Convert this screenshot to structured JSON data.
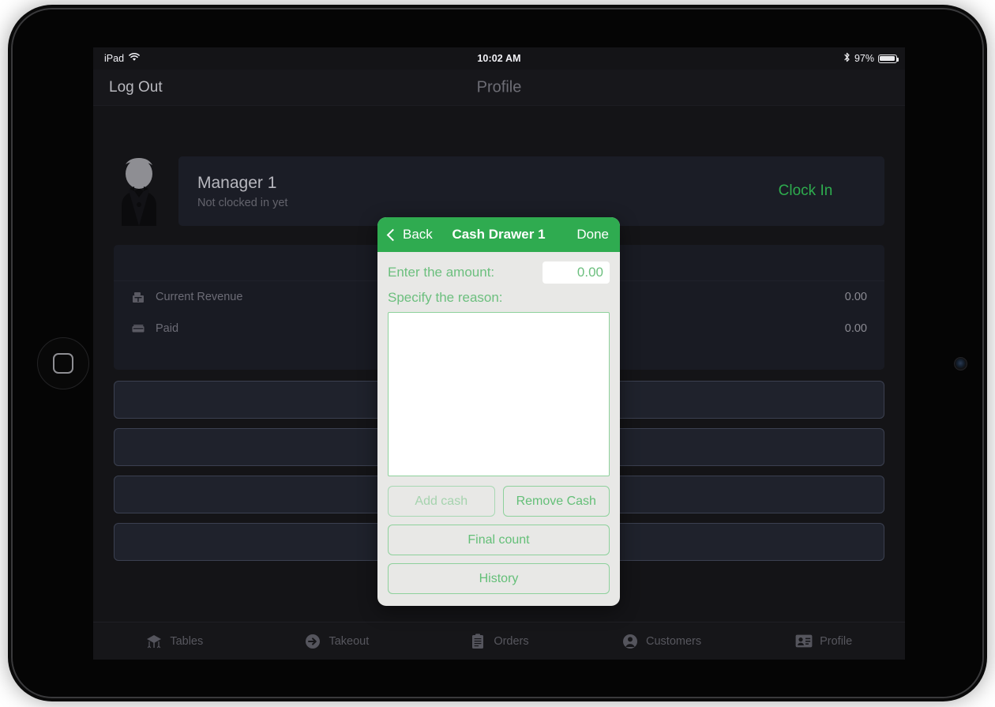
{
  "status_bar": {
    "device_label": "iPad",
    "wifi_icon": "wifi-icon",
    "time": "10:02 AM",
    "bluetooth_icon": "bluetooth-icon",
    "battery_percent": "97%",
    "battery_icon": "battery-icon"
  },
  "nav_bar": {
    "logout_label": "Log Out",
    "title": "Profile"
  },
  "profile": {
    "avatar_icon": "user-avatar-icon",
    "name": "Manager 1",
    "status": "Not clocked in yet",
    "clock_in_label": "Clock In"
  },
  "stats": {
    "rows": [
      {
        "icon": "register-icon",
        "label": "Current Revenue",
        "value": "0.00"
      },
      {
        "icon": "card-icon",
        "label": "Paid",
        "value": "0.00"
      }
    ]
  },
  "action_rows": [
    {
      "label": ""
    },
    {
      "label": ""
    },
    {
      "label": ""
    },
    {
      "label": ""
    }
  ],
  "tab_bar": {
    "items": [
      {
        "icon": "table-icon",
        "label": "Tables"
      },
      {
        "icon": "takeout-arrow-icon",
        "label": "Takeout"
      },
      {
        "icon": "clipboard-icon",
        "label": "Orders"
      },
      {
        "icon": "person-circle-icon",
        "label": "Customers"
      },
      {
        "icon": "id-card-icon",
        "label": "Profile"
      }
    ]
  },
  "modal": {
    "back_label": "Back",
    "back_icon": "chevron-left-icon",
    "title": "Cash Drawer 1",
    "done_label": "Done",
    "amount_label": "Enter the amount:",
    "amount_value": "0.00",
    "amount_placeholder": "0.00",
    "reason_label": "Specify the reason:",
    "reason_value": "",
    "reason_placeholder": "",
    "buttons": {
      "add_cash": "Add cash",
      "remove_cash": "Remove Cash",
      "final_count": "Final count",
      "history": "History"
    }
  },
  "colors": {
    "accent_green": "#2fab50",
    "modal_text_green": "#64bf78",
    "clock_in_green": "#2eac4e",
    "screen_bg": "#141417",
    "card_bg": "#1b1d26",
    "modal_bg": "#e8e8e6"
  }
}
